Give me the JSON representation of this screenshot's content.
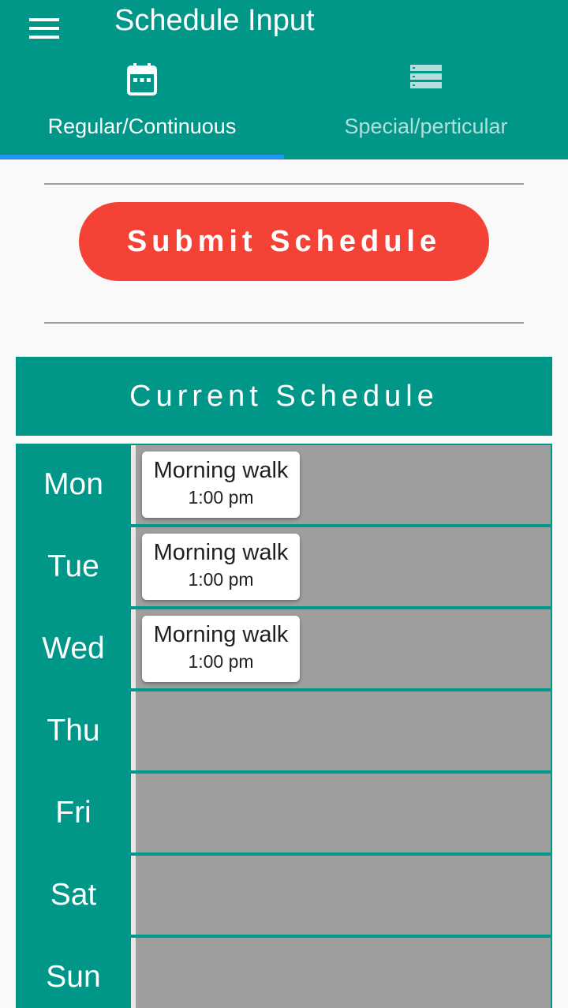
{
  "app_bar": {
    "title": "Schedule Input",
    "menu_icon": "hamburger-menu-icon"
  },
  "tabs": [
    {
      "label": "Regular/Continuous",
      "icon": "calendar-icon",
      "selected": true
    },
    {
      "label": "Special/perticular",
      "icon": "list-icon",
      "selected": false
    }
  ],
  "submit_button": {
    "label": "Submit Schedule"
  },
  "current_schedule": {
    "header": "Current Schedule",
    "days": [
      {
        "label": "Mon",
        "events": [
          {
            "title": "Morning walk",
            "time": "1:00 pm"
          }
        ]
      },
      {
        "label": "Tue",
        "events": [
          {
            "title": "Morning walk",
            "time": "1:00 pm"
          }
        ]
      },
      {
        "label": "Wed",
        "events": [
          {
            "title": "Morning walk",
            "time": "1:00 pm"
          }
        ]
      },
      {
        "label": "Thu",
        "events": []
      },
      {
        "label": "Fri",
        "events": []
      },
      {
        "label": "Sat",
        "events": []
      },
      {
        "label": "Sun",
        "events": []
      }
    ]
  },
  "colors": {
    "primary": "#009688",
    "tab_indicator": "#2196f3",
    "submit": "#f44336",
    "empty_day": "#9e9e9e",
    "inactive_tab_text": "#b2dfdb"
  }
}
